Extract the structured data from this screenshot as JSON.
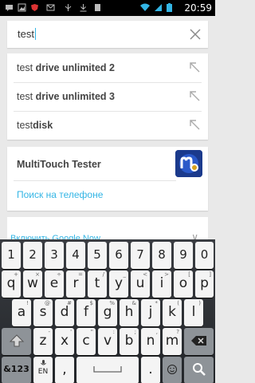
{
  "status_bar": {
    "time": "20:59",
    "icons": [
      "message-icon",
      "photo-icon",
      "shield-icon",
      "email-icon",
      "usb-icon",
      "download-icon",
      "sd-card-icon",
      "wifi-icon",
      "signal-icon",
      "battery-icon"
    ]
  },
  "search": {
    "query": "test",
    "clear_icon": "close-icon"
  },
  "suggestions": [
    {
      "prefix": "test",
      "bold": " drive unlimited 2"
    },
    {
      "prefix": "test",
      "bold": " drive unlimited 3"
    },
    {
      "prefix": "test",
      "bold": "disk"
    }
  ],
  "app_result": {
    "name": "MultiTouch Tester",
    "icon": "multitouch-tester-icon",
    "search_phone_label": "Поиск на телефоне"
  },
  "partially_hidden": {
    "label": "Включить Google Now"
  },
  "keyboard": {
    "row1": [
      {
        "label": "1"
      },
      {
        "label": "2"
      },
      {
        "label": "3"
      },
      {
        "label": "4"
      },
      {
        "label": "5"
      },
      {
        "label": "6"
      },
      {
        "label": "7"
      },
      {
        "label": "8"
      },
      {
        "label": "9"
      },
      {
        "label": "0"
      }
    ],
    "row2": [
      {
        "label": "q",
        "hint": "+"
      },
      {
        "label": "w",
        "hint": "×"
      },
      {
        "label": "e",
        "hint": "÷"
      },
      {
        "label": "r",
        "hint": "="
      },
      {
        "label": "t",
        "hint": "/"
      },
      {
        "label": "y",
        "hint": "_"
      },
      {
        "label": "u",
        "hint": "<"
      },
      {
        "label": "i",
        "hint": ">"
      },
      {
        "label": "o",
        "hint": "["
      },
      {
        "label": "p",
        "hint": "]"
      }
    ],
    "row3": [
      {
        "label": "a",
        "hint": "!"
      },
      {
        "label": "s",
        "hint": "@"
      },
      {
        "label": "d",
        "hint": "#"
      },
      {
        "label": "f",
        "hint": "$"
      },
      {
        "label": "g",
        "hint": "%"
      },
      {
        "label": "h",
        "hint": "&"
      },
      {
        "label": "j",
        "hint": "*"
      },
      {
        "label": "k",
        "hint": "("
      },
      {
        "label": "l",
        "hint": ")"
      }
    ],
    "row4": [
      {
        "label": "z",
        "hint": "-"
      },
      {
        "label": "x",
        "hint": "'"
      },
      {
        "label": "c",
        "hint": "\""
      },
      {
        "label": "v",
        "hint": ":"
      },
      {
        "label": "b",
        "hint": ";"
      },
      {
        "label": "n",
        "hint": ","
      },
      {
        "label": "m",
        "hint": "?"
      }
    ],
    "symbols_label": "&123",
    "lang_label": "EN",
    "comma_label": ",",
    "period_label": "."
  }
}
